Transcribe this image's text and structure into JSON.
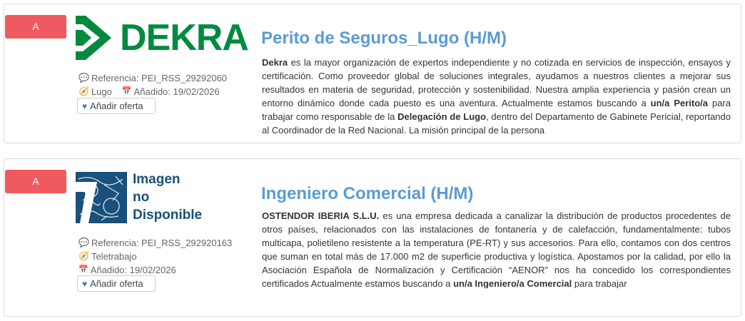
{
  "offers": [
    {
      "badge": "A",
      "logo_text": "DEKRA",
      "title": "Perito de Seguros_Lugo (H/M)",
      "reference": "Referencia: PEI_RSS_29292060",
      "location": "Lugo",
      "added": "Añadido: 19/02/2026",
      "fav_label": "Añadir oferta",
      "desc": {
        "company": "Dekra",
        "p1": " es la mayor organización de expertos independiente y no cotizada en servicios de inspección, ensayos y certificación. Como proveedor global de soluciones integrales, ayudamos a nuestros clientes a mejorar sus resultados en materia de seguridad, protección y sostenibilidad. Nuestra amplia experiencia y pasión crean un entorno dinámico donde cada puesto es una aventura. Actualmente estamos buscando a ",
        "b1": "un/a Perito/a",
        "p2": " para trabajar como responsable de la ",
        "b2": "Delegación de Lugo",
        "p3": ", dentro del Departamento de Gabinete Pericial, reportando al Coordinador de la Red Nacional. La misión principal de la persona"
      }
    },
    {
      "badge": "A",
      "logo_text": [
        "Imagen",
        "no",
        "Disponible"
      ],
      "title": "Ingeniero Comercial (H/M)",
      "reference": "Referencia: PEI_RSS_292920163",
      "location": "Teletrabajo",
      "added": "Añadido: 19/02/2026",
      "fav_label": "Añadir oferta",
      "desc": {
        "company": "OSTENDOR IBERIA S.L.U.",
        "p1": " es una empresa dedicada a canalizar la distribución de productos procedentes de otros países, relacionados con las instalaciones de fontanería y de calefacción, fundamentalmente: tubos multicapa, polietileno resistente a la temperatura (PE-RT) y sus accesorios. Para ello, contamos con dos centros que suman en total más de 17.000 m2 de superficie productiva y logística. Apostamos por la calidad, por ello la Asociación Española de Normalización y Certificación “AENOR” nos ha concedido los correspondientes certificados Actualmente estamos buscando a ",
        "b1": "un/a Ingeniero/a Comercial",
        "p2": " para trabajar"
      }
    }
  ],
  "colors": {
    "badge": "#ef5a60",
    "title": "#5b9bd5",
    "dekra_green": "#008a3e",
    "noimg_blue": "#19507c"
  },
  "icons": [
    "comments-icon",
    "compass-icon",
    "calendar-icon",
    "heart-icon"
  ]
}
